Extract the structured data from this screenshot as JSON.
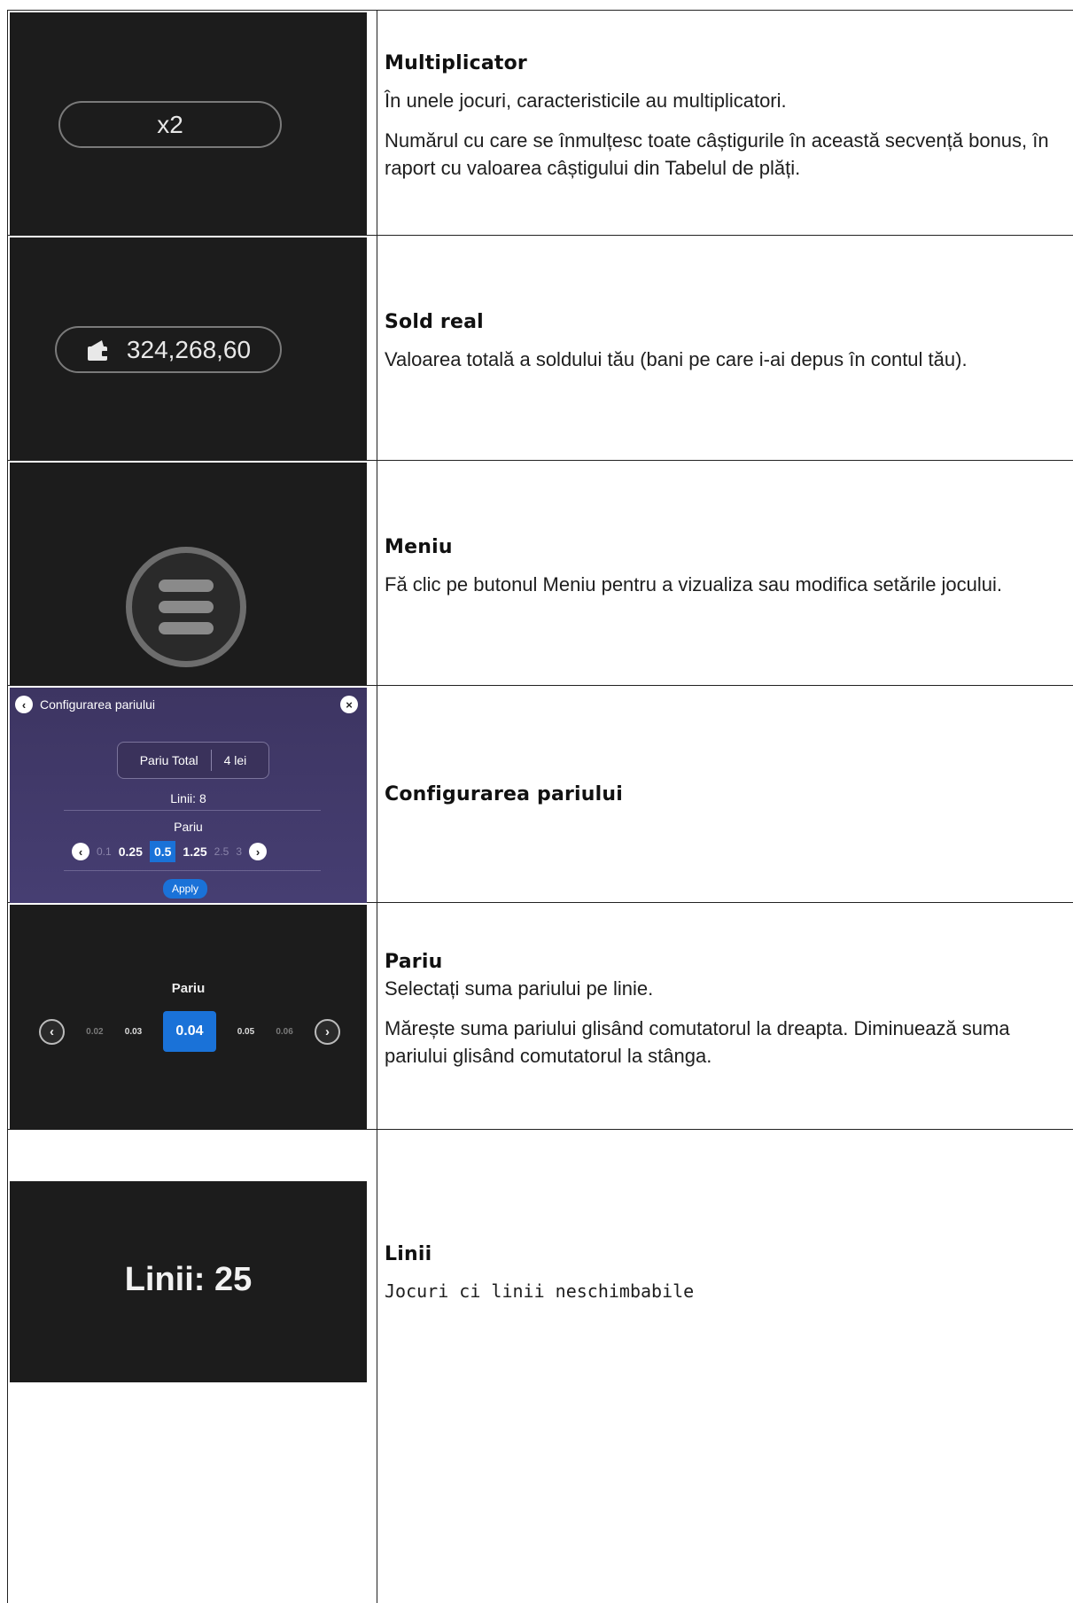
{
  "rows": [
    {
      "visual": {
        "multiplier": "x2"
      },
      "title": "Multiplicator",
      "paragraphs": [
        "În unele jocuri, caracteristicile au multiplicatori.",
        "Numărul cu care se înmulțesc toate câștigurile în această secvență bonus, în raport cu valoarea câștigului din Tabelul de plăți."
      ]
    },
    {
      "visual": {
        "balance": "324,268,60",
        "icon": "wallet-icon"
      },
      "title": "Sold real",
      "paragraphs": [
        "Valoarea totală a soldului tău (bani pe care i-ai depus în contul tău)."
      ]
    },
    {
      "visual": {
        "icon": "menu-icon"
      },
      "title": "Meniu",
      "paragraphs": [
        "Fă clic pe butonul Meniu pentru a vizualiza sau modifica setările jocului."
      ]
    },
    {
      "visual": {
        "panel_title": "Configurarea pariului",
        "total_label": "Pariu Total",
        "total_value": "4 lei",
        "lines": "Linii: 8",
        "bet_label": "Pariu",
        "bet_values": [
          "0.1",
          "0.25",
          "0.5",
          "1.25",
          "2.5",
          "3"
        ],
        "bet_selected": "0.5",
        "apply_label": "Apply"
      },
      "title": "Configurarea pariului",
      "paragraphs": []
    },
    {
      "visual": {
        "label": "Pariu",
        "values": [
          "0.02",
          "0.03",
          "0.04",
          "0.05",
          "0.06"
        ],
        "selected": "0.04"
      },
      "title": "Pariu",
      "paragraphs": [
        "Selectați suma pariului pe linie.",
        "Mărește suma pariului glisând comutatorul la dreapta. Diminuează suma pariului glisând comutatorul la stânga."
      ]
    },
    {
      "visual": {
        "lines": "Linii: 25"
      },
      "title": "Linii",
      "paragraphs": [
        "Jocuri ci linii neschimbabile"
      ]
    }
  ],
  "colors": {
    "dark_panel": "#1c1c1c",
    "accent_blue": "#1a72d8",
    "config_purple": "#3d3562"
  }
}
